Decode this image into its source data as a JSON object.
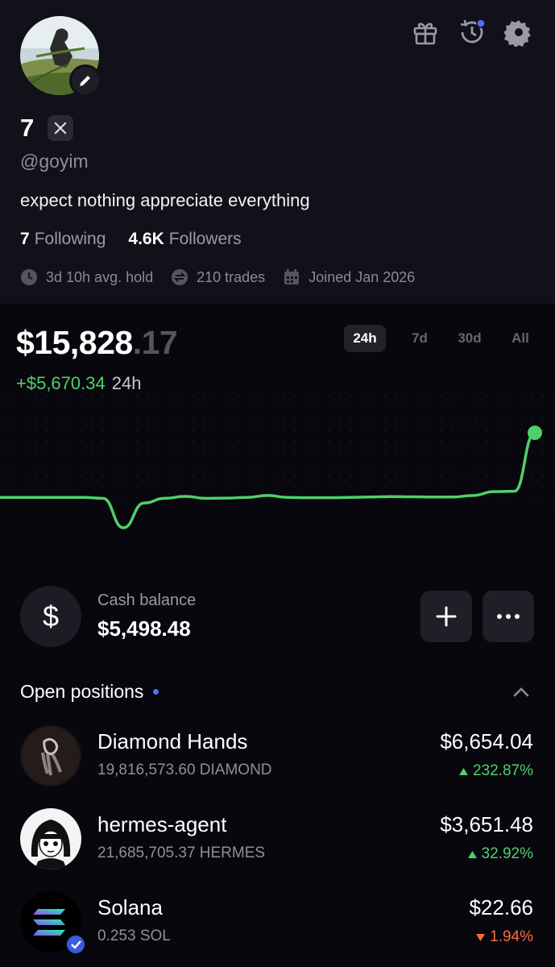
{
  "profile": {
    "name": "7",
    "handle": "@goyim",
    "bio": "expect nothing appreciate everything",
    "following_count": "7",
    "following_label": "Following",
    "followers_count": "4.6K",
    "followers_label": "Followers",
    "stats": {
      "avg_hold": "3d 10h avg. hold",
      "trades": "210 trades",
      "joined": "Joined Jan 2026"
    }
  },
  "portfolio": {
    "balance_main": "$15,828",
    "balance_cents": ".17",
    "change_amount": "+$5,670.34",
    "change_period": "24h",
    "ranges": [
      "24h",
      "7d",
      "30d",
      "All"
    ],
    "selected_range": "24h"
  },
  "cash": {
    "label": "Cash balance",
    "value": "$5,498.48",
    "symbol": "$"
  },
  "positions": {
    "title": "Open positions",
    "items": [
      {
        "name": "Diamond Hands",
        "qty": "19,816,573.60 DIAMOND",
        "value": "$6,654.04",
        "change": "232.87%",
        "direction": "up"
      },
      {
        "name": "hermes-agent",
        "qty": "21,685,705.37 HERMES",
        "value": "$3,651.48",
        "change": "32.92%",
        "direction": "up"
      },
      {
        "name": "Solana",
        "qty": "0.253 SOL",
        "value": "$22.66",
        "change": "1.94%",
        "direction": "down"
      }
    ]
  },
  "icons": {
    "gift": "gift-icon",
    "history": "history-icon",
    "settings": "gear-icon",
    "edit": "pencil-icon",
    "x_logo": "x-logo-icon"
  },
  "colors": {
    "positive": "#4fd06a",
    "negative": "#ff6a3d",
    "accent": "#5b6cf3",
    "background": "#07070d",
    "header_background": "#111119"
  },
  "chart_data": {
    "type": "line",
    "period": "24h",
    "values": [
      15.9,
      15.9,
      15.9,
      15.9,
      15.9,
      15.85,
      14.3,
      15.6,
      15.85,
      15.95,
      15.85,
      15.86,
      15.9,
      16.0,
      15.9,
      15.88,
      15.88,
      15.9,
      15.92,
      15.94,
      15.93,
      15.92,
      15.92,
      16.0,
      16.2,
      16.22,
      19.3
    ],
    "end_marker": true
  }
}
